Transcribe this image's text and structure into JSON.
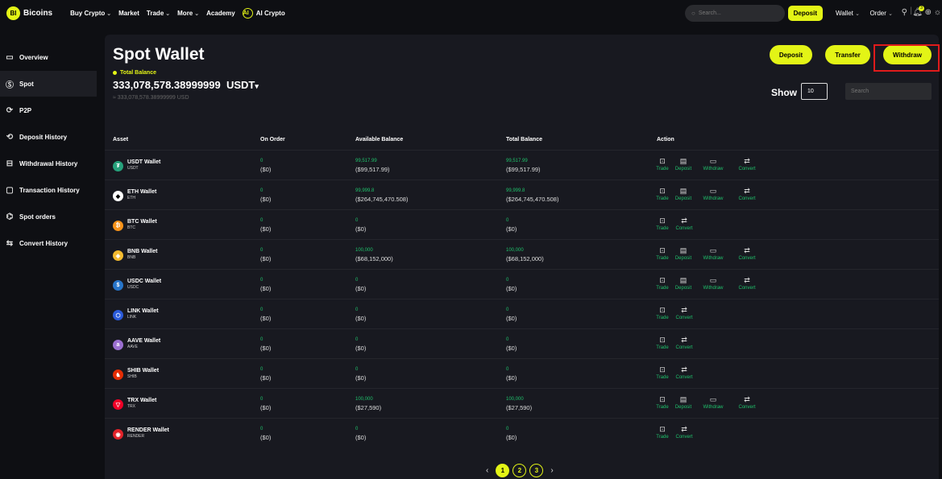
{
  "header": {
    "logo_mark": "BI",
    "brand": "Bicoins",
    "nav": [
      {
        "label": "Buy Crypto",
        "dropdown": true
      },
      {
        "label": "Market",
        "dropdown": false
      },
      {
        "label": "Trade",
        "dropdown": true
      },
      {
        "label": "More",
        "dropdown": true
      },
      {
        "label": "Academy",
        "dropdown": false
      },
      {
        "label": "AI Crypto",
        "dropdown": false
      }
    ],
    "search_placeholder": "Search...",
    "deposit_label": "Deposit",
    "wallet_label": "Wallet",
    "order_label": "Order",
    "notification_count": "3"
  },
  "sidebar": {
    "items": [
      {
        "label": "Overview",
        "icon": "wallet-icon"
      },
      {
        "label": "Spot",
        "icon": "dollar-icon",
        "active": true
      },
      {
        "label": "P2P",
        "icon": "p2p-icon"
      },
      {
        "label": "Deposit History",
        "icon": "deposit-icon"
      },
      {
        "label": "Withdrawal History",
        "icon": "withdraw-icon"
      },
      {
        "label": "Transaction History",
        "icon": "transaction-icon"
      },
      {
        "label": "Spot orders",
        "icon": "orders-icon"
      },
      {
        "label": "Convert History",
        "icon": "convert-icon"
      }
    ]
  },
  "main": {
    "title": "Spot Wallet",
    "total_balance_label": "Total Balance",
    "total_balance": "333,078,578.38999999",
    "currency": "USDT",
    "total_balance_usd": "≈ 333,078,578.38999999 USD",
    "buttons": {
      "deposit": "Deposit",
      "transfer": "Transfer",
      "withdraw": "Withdraw"
    },
    "show_label": "Show",
    "show_value": "10",
    "search_placeholder": "Search",
    "columns": [
      "Asset",
      "On Order",
      "Available Balance",
      "Total Balance",
      "Action"
    ],
    "rows": [
      {
        "name": "USDT Wallet",
        "symbol": "USDT",
        "color": "#26a17b",
        "glyph": "₮",
        "on_order": "0",
        "on_order_usd": "($0)",
        "available": "99,517.99",
        "available_usd": "($99,517.99)",
        "total": "99,517.99",
        "total_usd": "($99,517.99)",
        "actions": [
          "Trade",
          "Deposit",
          "Withdraw",
          "Convert"
        ]
      },
      {
        "name": "ETH Wallet",
        "symbol": "ETH",
        "color": "#ffffff",
        "glyph": "◆",
        "on_order": "0",
        "on_order_usd": "($0)",
        "available": "99,999.8",
        "available_usd": "($264,745,470.508)",
        "total": "99,999.8",
        "total_usd": "($264,745,470.508)",
        "actions": [
          "Trade",
          "Deposit",
          "Withdraw",
          "Convert"
        ]
      },
      {
        "name": "BTC Wallet",
        "symbol": "BTC",
        "color": "#f7931a",
        "glyph": "₿",
        "on_order": "0",
        "on_order_usd": "($0)",
        "available": "0",
        "available_usd": "($0)",
        "total": "0",
        "total_usd": "($0)",
        "actions": [
          "Trade",
          "Convert"
        ]
      },
      {
        "name": "BNB Wallet",
        "symbol": "BNB",
        "color": "#f3ba2f",
        "glyph": "◈",
        "on_order": "0",
        "on_order_usd": "($0)",
        "available": "100,000",
        "available_usd": "($68,152,000)",
        "total": "100,000",
        "total_usd": "($68,152,000)",
        "actions": [
          "Trade",
          "Deposit",
          "Withdraw",
          "Convert"
        ]
      },
      {
        "name": "USDC Wallet",
        "symbol": "USDC",
        "color": "#2775ca",
        "glyph": "$",
        "on_order": "0",
        "on_order_usd": "($0)",
        "available": "0",
        "available_usd": "($0)",
        "total": "0",
        "total_usd": "($0)",
        "actions": [
          "Trade",
          "Deposit",
          "Withdraw",
          "Convert"
        ]
      },
      {
        "name": "LINK Wallet",
        "symbol": "LINK",
        "color": "#2a5ada",
        "glyph": "⬡",
        "on_order": "0",
        "on_order_usd": "($0)",
        "available": "0",
        "available_usd": "($0)",
        "total": "0",
        "total_usd": "($0)",
        "actions": [
          "Trade",
          "Convert"
        ]
      },
      {
        "name": "AAVE Wallet",
        "symbol": "AAVE",
        "color": "#9b6fd0",
        "glyph": "a",
        "on_order": "0",
        "on_order_usd": "($0)",
        "available": "0",
        "available_usd": "($0)",
        "total": "0",
        "total_usd": "($0)",
        "actions": [
          "Trade",
          "Convert"
        ]
      },
      {
        "name": "SHIB Wallet",
        "symbol": "SHIB",
        "color": "#e42d04",
        "glyph": "♞",
        "on_order": "0",
        "on_order_usd": "($0)",
        "available": "0",
        "available_usd": "($0)",
        "total": "0",
        "total_usd": "($0)",
        "actions": [
          "Trade",
          "Convert"
        ]
      },
      {
        "name": "TRX Wallet",
        "symbol": "TRX",
        "color": "#ef0027",
        "glyph": "▽",
        "on_order": "0",
        "on_order_usd": "($0)",
        "available": "100,000",
        "available_usd": "($27,590)",
        "total": "100,000",
        "total_usd": "($27,590)",
        "actions": [
          "Trade",
          "Deposit",
          "Withdraw",
          "Convert"
        ]
      },
      {
        "name": "RENDER Wallet",
        "symbol": "RENDER",
        "color": "#e1232a",
        "glyph": "◉",
        "on_order": "0",
        "on_order_usd": "($0)",
        "available": "0",
        "available_usd": "($0)",
        "total": "0",
        "total_usd": "($0)",
        "actions": [
          "Trade",
          "Convert"
        ]
      }
    ],
    "pagination": {
      "pages": [
        "1",
        "2",
        "3"
      ],
      "current": "1",
      "prev": "‹",
      "next": "›"
    }
  },
  "colors": {
    "accent": "#e3f416",
    "positive": "#1fc16b",
    "highlight": "#e01b1b"
  }
}
